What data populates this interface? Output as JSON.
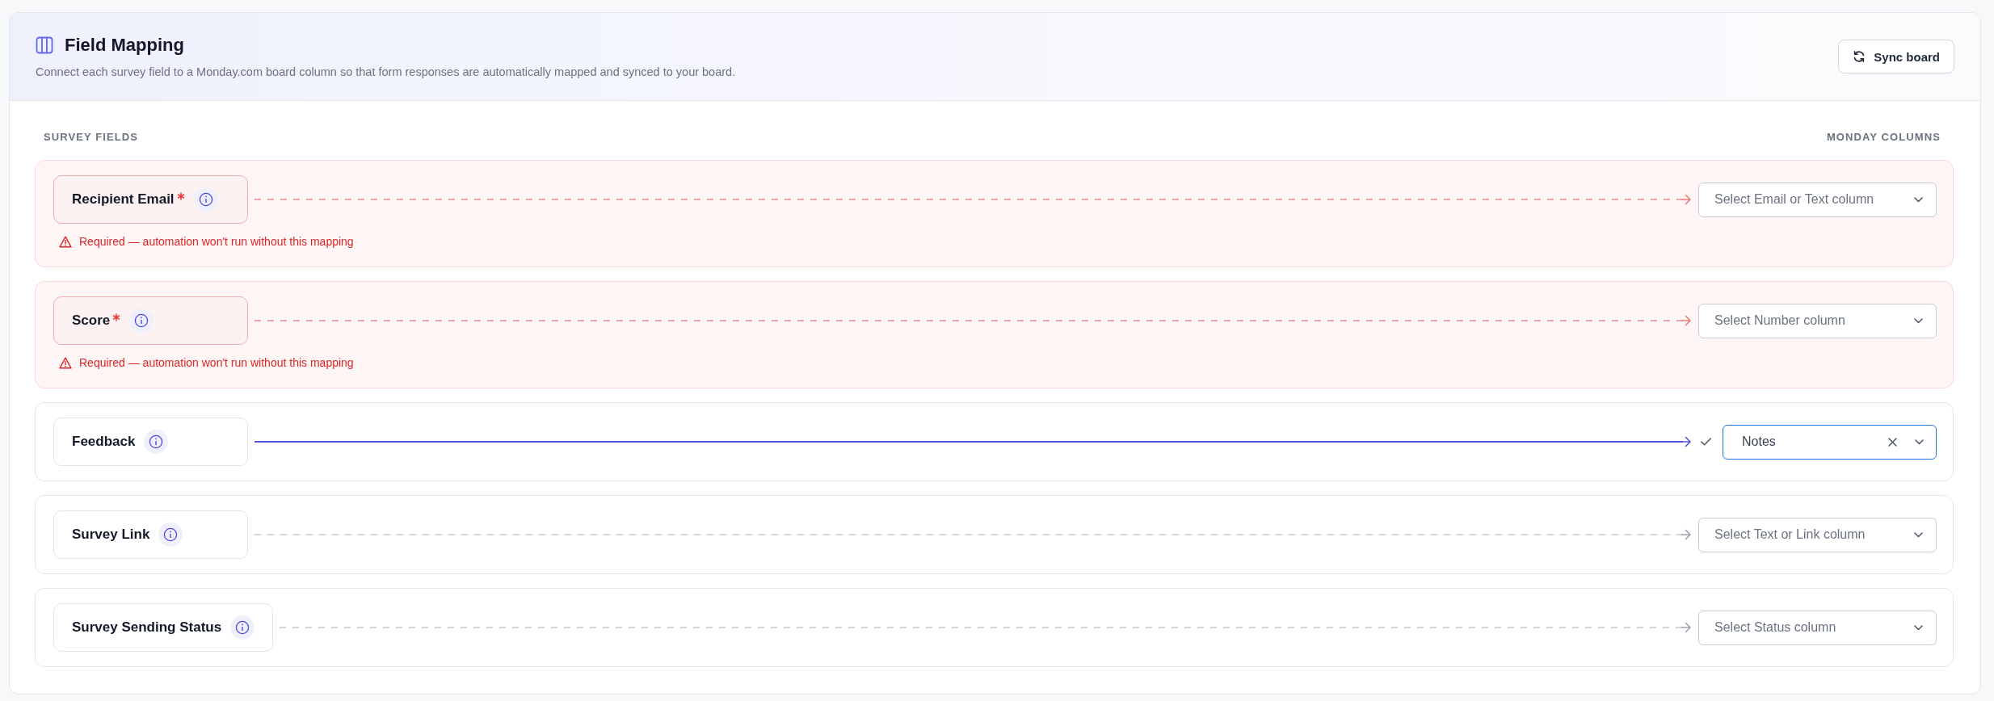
{
  "header": {
    "title": "Field Mapping",
    "subtitle": "Connect each survey field to a Monday.com board column so that form responses are automatically mapped and synced to your board.",
    "sync_button": "Sync board"
  },
  "column_headings": {
    "left": "SURVEY FIELDS",
    "right": "MONDAY COLUMNS"
  },
  "fields": [
    {
      "name": "Recipient Email",
      "required": true,
      "error": true,
      "warning": "Required — automation won't run without this mapping",
      "mapped": false,
      "column": {
        "placeholder": "Select Email or Text column"
      }
    },
    {
      "name": "Score",
      "required": true,
      "error": true,
      "warning": "Required — automation won't run without this mapping",
      "mapped": false,
      "column": {
        "placeholder": "Select Number column"
      }
    },
    {
      "name": "Feedback",
      "required": false,
      "error": false,
      "mapped": true,
      "column": {
        "value": "Notes"
      }
    },
    {
      "name": "Survey Link",
      "required": false,
      "error": false,
      "mapped": false,
      "column": {
        "placeholder": "Select Text or Link column"
      }
    },
    {
      "name": "Survey Sending Status",
      "required": false,
      "error": false,
      "mapped": false,
      "column": {
        "placeholder": "Select Status column"
      }
    }
  ]
}
